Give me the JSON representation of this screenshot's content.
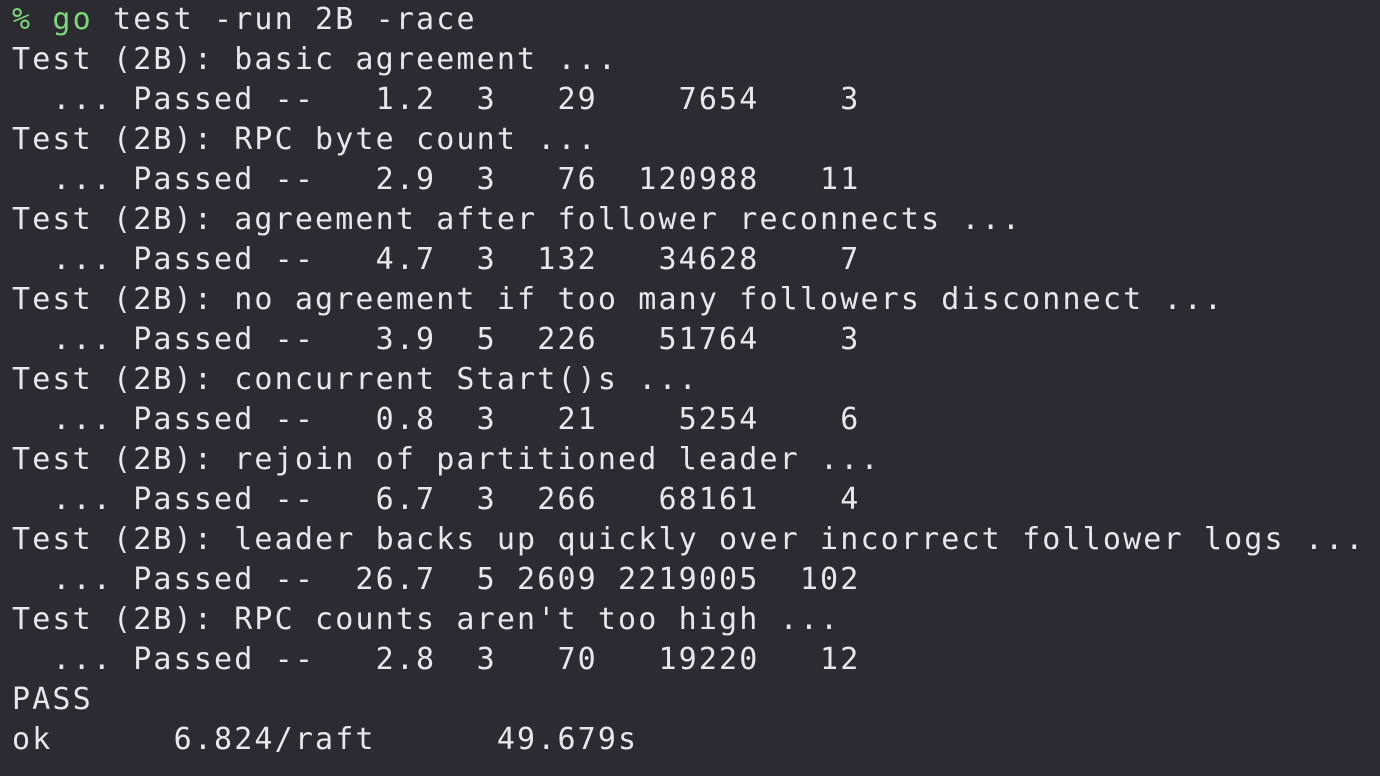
{
  "terminal": {
    "prompt_symbol": "%",
    "command": {
      "program": "go",
      "args": " test -run 2B -race"
    },
    "lines": [
      "Test (2B): basic agreement ...",
      "  ... Passed --   1.2  3   29    7654    3",
      "Test (2B): RPC byte count ...",
      "  ... Passed --   2.9  3   76  120988   11",
      "Test (2B): agreement after follower reconnects ...",
      "  ... Passed --   4.7  3  132   34628    7",
      "Test (2B): no agreement if too many followers disconnect ...",
      "  ... Passed --   3.9  5  226   51764    3",
      "Test (2B): concurrent Start()s ...",
      "  ... Passed --   0.8  3   21    5254    6",
      "Test (2B): rejoin of partitioned leader ...",
      "  ... Passed --   6.7  3  266   68161    4",
      "Test (2B): leader backs up quickly over incorrect follower logs ...",
      "  ... Passed --  26.7  5 2609 2219005  102",
      "Test (2B): RPC counts aren't too high ...",
      "  ... Passed --   2.8  3   70   19220   12",
      "PASS",
      "ok      6.824/raft      49.679s"
    ]
  },
  "colors": {
    "background": "#2b2b30",
    "foreground": "#e8e8ea",
    "prompt_green": "#7dd87d"
  }
}
